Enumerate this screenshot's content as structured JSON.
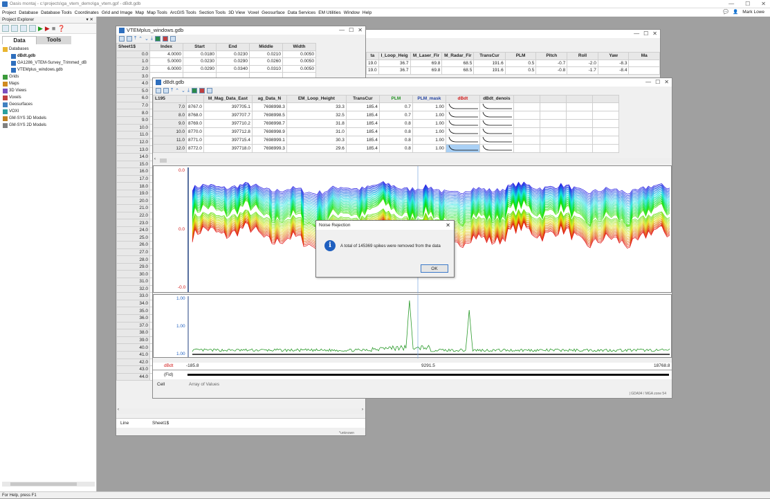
{
  "title_bar": {
    "title": "Oasis montaj - c:\\projects\\ga_vtem_demo\\ga_vtem.gpf - dBdt.gdb",
    "minimize": "—",
    "maximize": "☐",
    "close": "✕"
  },
  "menu": {
    "items": [
      "Project",
      "Database",
      "Database Tools",
      "Coordinates",
      "Grid and Image",
      "Map",
      "Map Tools",
      "ArcGIS Tools",
      "Section Tools",
      "3D View",
      "Voxel",
      "Geosurface",
      "Data Services",
      "EM Utilities",
      "Window",
      "Help"
    ],
    "user": "Mark Lowe"
  },
  "explorer": {
    "title": "Project Explorer",
    "tabs": [
      "Data",
      "Tools"
    ],
    "tree": [
      {
        "label": "Databases",
        "level": 0,
        "icon": "folder-icon"
      },
      {
        "label": "dBdt.gdb",
        "level": 1,
        "icon": "database-icon",
        "bold": true
      },
      {
        "label": "GA1286_VTEM-Survey_Trimmed_dB",
        "level": 1,
        "icon": "database-icon"
      },
      {
        "label": "VTEMplus_windows.gdb",
        "level": 1,
        "icon": "database-icon"
      },
      {
        "label": "Grids",
        "level": 0,
        "icon": "grid-icon"
      },
      {
        "label": "Maps",
        "level": 0,
        "icon": "map-icon"
      },
      {
        "label": "3D Views",
        "level": 0,
        "icon": "3d-view-icon"
      },
      {
        "label": "Voxels",
        "level": 0,
        "icon": "voxel-icon"
      },
      {
        "label": "Geosurfaces",
        "level": 0,
        "icon": "geosurface-icon"
      },
      {
        "label": "VOXI",
        "level": 0,
        "icon": "voxi-icon"
      },
      {
        "label": "GM-SYS 3D Models",
        "level": 0,
        "icon": "gmsys3d-icon"
      },
      {
        "label": "GM-SYS 2D Models",
        "level": 0,
        "icon": "gmsys2d-icon"
      }
    ]
  },
  "vtem_window": {
    "title": "VTEMplus_windows.gdb",
    "sheet": "Sheet1$",
    "columns": [
      "Index",
      "Start",
      "End",
      "Middle",
      "Width"
    ],
    "rows": [
      [
        "0.0",
        "4.0000",
        "0.0180",
        "0.0230",
        "0.0210",
        "0.0050"
      ],
      [
        "1.0",
        "5.0000",
        "0.0230",
        "0.0290",
        "0.0260",
        "0.0050"
      ],
      [
        "2.0",
        "6.0000",
        "0.0290",
        "0.0340",
        "0.0310",
        "0.0050"
      ]
    ],
    "rownums": [
      "3.0",
      "4.0",
      "5.0",
      "6.0",
      "7.0",
      "8.0",
      "9.0",
      "10.0",
      "11.0",
      "12.0",
      "13.0",
      "14.0",
      "15.0",
      "16.0",
      "17.0",
      "18.0",
      "19.0",
      "20.0",
      "21.0",
      "22.0",
      "23.0",
      "24.0",
      "25.0",
      "26.0",
      "27.0",
      "28.0",
      "29.0",
      "30.0",
      "31.0",
      "32.0",
      "33.0",
      "34.0",
      "35.0",
      "36.0",
      "37.0",
      "38.0",
      "39.0",
      "40.0",
      "41.0",
      "42.0",
      "43.0",
      "44.0"
    ],
    "line_label": "Line",
    "line_value": "Sheet1$",
    "status": "*unknown"
  },
  "third_window": {
    "columns": [
      "ta",
      "I_Loop_Heig",
      "M_Laser_Fir",
      "M_Radar_Fir",
      "TransCur",
      "PLM",
      "Pitch",
      "Roll",
      "Yaw",
      "Ma"
    ],
    "rows": [
      [
        "19.0",
        "36.7",
        "69.8",
        "68.5",
        "191.6",
        "0.5",
        "-0.7",
        "-2.0",
        "-8.3"
      ],
      [
        "19.0",
        "36.7",
        "69.8",
        "68.5",
        "191.6",
        "0.5",
        "-0.8",
        "-1.7",
        "-8.4"
      ]
    ]
  },
  "dbdt_window": {
    "title": "dBdt.gdb",
    "line": "L195",
    "columns": [
      "M_Mag_Data_East",
      "ag_Data_N",
      "EM_Loop_Height",
      "TransCur",
      "PLM",
      "PLM_mask",
      "dBdt",
      "dBdt_denois"
    ],
    "rows": [
      [
        "7.0",
        "8767.0",
        "397705.1",
        "7698998.3",
        "33.3",
        "185.4",
        "0.7",
        "1.00"
      ],
      [
        "8.0",
        "8768.0",
        "397707.7",
        "7698998.5",
        "32.5",
        "185.4",
        "0.7",
        "1.00"
      ],
      [
        "9.0",
        "8769.0",
        "397710.2",
        "7698998.7",
        "31.8",
        "185.4",
        "0.8",
        "1.00"
      ],
      [
        "10.0",
        "8770.0",
        "397712.8",
        "7698998.9",
        "31.0",
        "185.4",
        "0.8",
        "1.00"
      ],
      [
        "11.0",
        "8771.0",
        "397715.4",
        "7698999.1",
        "30.3",
        "185.4",
        "0.8",
        "1.00"
      ],
      [
        "12.0",
        "8772.0",
        "397718.0",
        "7698999.3",
        "29.6",
        "185.4",
        "0.8",
        "1.00"
      ]
    ],
    "plot1_ticks": [
      "0.0",
      "0.0",
      "-0.0"
    ],
    "plot2_ticks": [
      "1.00",
      "1.00",
      "1.00"
    ],
    "xaxis_label": "dBdt",
    "x_ticks": [
      "-185.8",
      "9291.5",
      "18768.8"
    ],
    "fid_label": "(Fid)",
    "cell_label": "Cell",
    "cell_value": "Array of Values",
    "coord_status": "| GDA94 / MGA zone 54"
  },
  "dialog": {
    "title": "Noise Rejection",
    "message": "A total of 145369 spikes were removed from the data",
    "ok": "OK",
    "close": "✕"
  },
  "status_bar": {
    "text": "For Help, press F1"
  },
  "colors": {
    "accent": "#2e6fbe",
    "info": "#1f5fbf",
    "plm_green": "#1f8f1f",
    "dbdt_red": "#d01818"
  }
}
